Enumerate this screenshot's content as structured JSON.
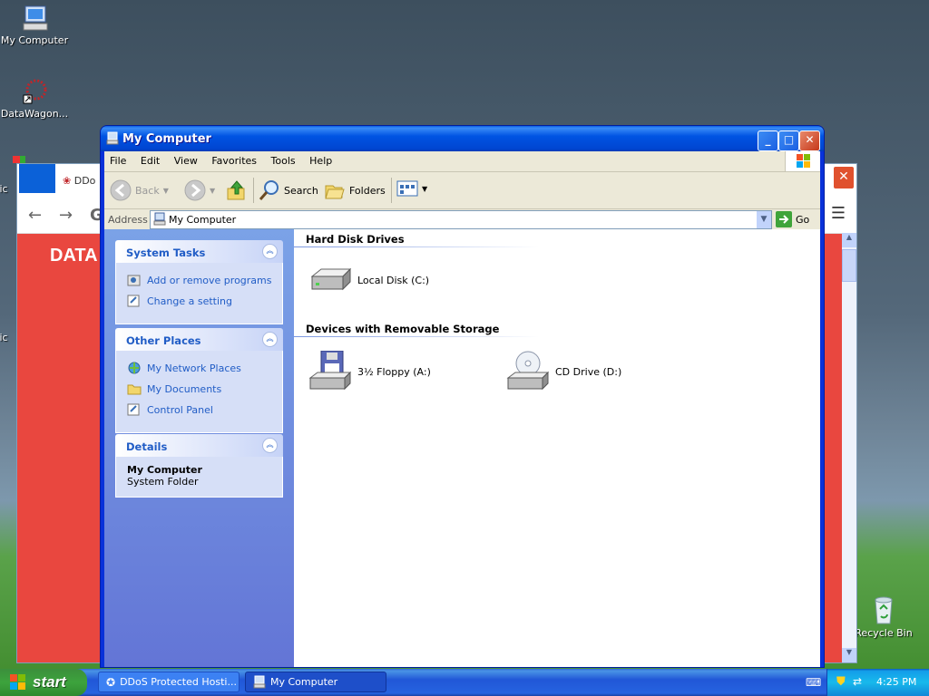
{
  "desktop": {
    "icons": [
      {
        "label": "My Computer"
      },
      {
        "label": "DataWagon..."
      },
      {
        "label": "Mic"
      },
      {
        "label": "Mic"
      },
      {
        "label": "Recycle Bin"
      }
    ]
  },
  "browser": {
    "tab_title": "DDo",
    "brand_text": "DATA"
  },
  "window": {
    "title": "My Computer",
    "menu": [
      "File",
      "Edit",
      "View",
      "Favorites",
      "Tools",
      "Help"
    ],
    "toolbar": {
      "back": "Back",
      "search": "Search",
      "folders": "Folders"
    },
    "address": {
      "label": "Address",
      "value": "My Computer",
      "go": "Go"
    },
    "system_tasks": {
      "title": "System Tasks",
      "items": [
        "Add or remove programs",
        "Change a setting"
      ]
    },
    "other_places": {
      "title": "Other Places",
      "items": [
        "My Network Places",
        "My Documents",
        "Control Panel"
      ]
    },
    "details": {
      "title": "Details",
      "name": "My Computer",
      "type": "System Folder"
    },
    "groups": [
      {
        "title": "Hard Disk Drives",
        "drives": [
          "Local Disk (C:)"
        ]
      },
      {
        "title": "Devices with Removable Storage",
        "drives": [
          "3½ Floppy (A:)",
          "CD Drive (D:)"
        ]
      }
    ]
  },
  "taskbar": {
    "start": "start",
    "tasks": [
      "DDoS Protected Hosti...",
      "My Computer"
    ],
    "clock": "4:25 PM"
  }
}
